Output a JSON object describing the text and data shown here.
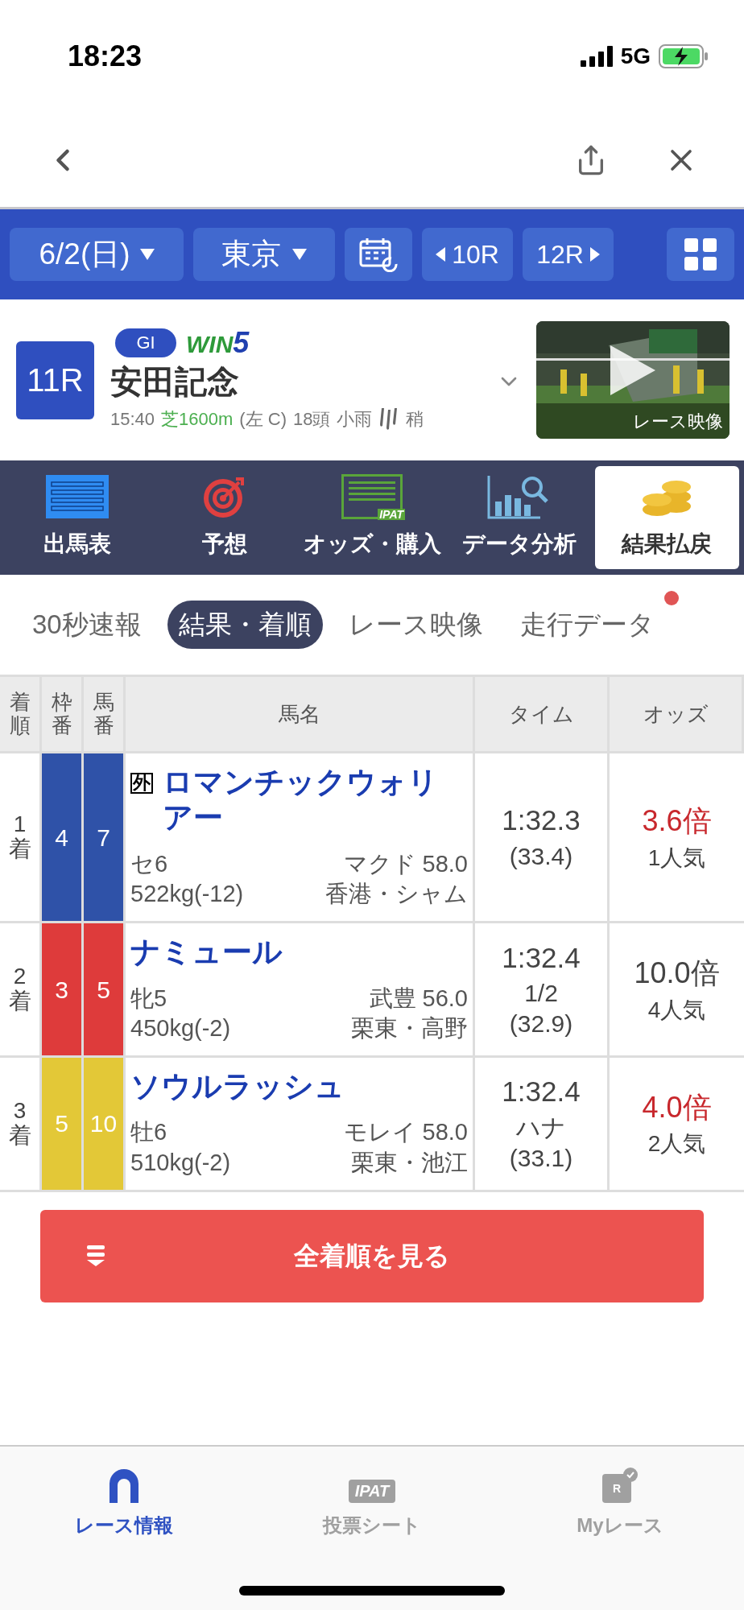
{
  "status_bar": {
    "time": "18:23",
    "network": "5G"
  },
  "race_nav": {
    "date": "6/2(日)",
    "venue": "東京",
    "prev": "10R",
    "next": "12R"
  },
  "race": {
    "number": "11R",
    "grade": "GI",
    "win5": {
      "prefix": "WIN",
      "suffix": "5"
    },
    "title": "安田記念",
    "start": "15:40",
    "course": "芝1600m",
    "direction": "(左 C)",
    "runners": "18頭",
    "weather": "小雨",
    "going": "稍",
    "video_label": "レース映像"
  },
  "menu": [
    {
      "label": "出馬表",
      "kind": "list",
      "selected": false
    },
    {
      "label": "予想",
      "kind": "target",
      "selected": false
    },
    {
      "label": "オッズ・購入",
      "kind": "ipat",
      "icon_text": "IPAT",
      "selected": false
    },
    {
      "label": "データ分析",
      "kind": "chart",
      "selected": false
    },
    {
      "label": "結果払戻",
      "kind": "coins",
      "selected": true
    }
  ],
  "subtabs": [
    {
      "label": "30秒速報",
      "selected": false,
      "badge": false
    },
    {
      "label": "結果・着順",
      "selected": true,
      "badge": false
    },
    {
      "label": "レース映像",
      "selected": false,
      "badge": false
    },
    {
      "label": "走行データ",
      "selected": false,
      "badge": true
    }
  ],
  "table": {
    "columns": [
      "着順",
      "枠番",
      "馬番",
      "馬名",
      "タイム",
      "オッズ"
    ],
    "rows": [
      {
        "rank": "1着",
        "frame": {
          "text": "4",
          "color": "#2f52a8"
        },
        "number": "7",
        "mark": "外",
        "name": "ロマンチックウォリアー",
        "sex_age": "セ6",
        "jockey": "マクド 58.0",
        "weight": "522kg(-12)",
        "trainer": "香港・シャム",
        "time": "1:32.3",
        "last3f": "(33.4)",
        "odds": {
          "text": "3.6倍",
          "color": "#c8282d"
        },
        "popularity": "1人気"
      },
      {
        "rank": "2着",
        "frame": {
          "text": "3",
          "color": "#de3b3b"
        },
        "number": "5",
        "name": "ナミュール",
        "sex_age": "牝5",
        "jockey": "武豊 56.0",
        "weight": "450kg(-2)",
        "trainer": "栗東・高野",
        "time": "1:32.4",
        "margin": "1/2",
        "last3f": "(32.9)",
        "odds": {
          "text": "10.0倍",
          "color": "#444444"
        },
        "popularity": "4人気"
      },
      {
        "rank": "3着",
        "frame": {
          "text": "5",
          "color": "#e3c837"
        },
        "number": "10",
        "name": "ソウルラッシュ",
        "sex_age": "牡6",
        "jockey": "モレイ 58.0",
        "weight": "510kg(-2)",
        "trainer": "栗東・池江",
        "time": "1:32.4",
        "margin": "ハナ",
        "last3f": "(33.1)",
        "odds": {
          "text": "4.0倍",
          "color": "#c8282d"
        },
        "popularity": "2人気"
      }
    ]
  },
  "all_results_button": "全着順を見る",
  "bottom_nav": [
    {
      "label": "レース情報",
      "kind": "horseshoe",
      "selected": true
    },
    {
      "label": "投票シート",
      "kind": "ipat",
      "icon_text": "IPAT",
      "selected": false
    },
    {
      "label": "Myレース",
      "kind": "myrace",
      "icon_text": "R",
      "selected": false
    }
  ]
}
